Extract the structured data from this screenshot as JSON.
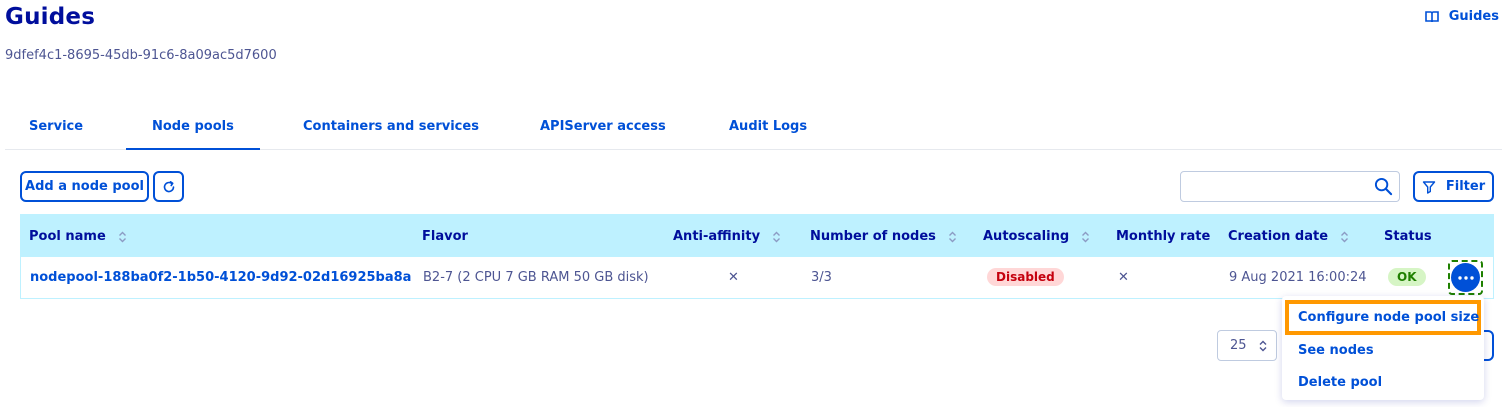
{
  "header": {
    "title": "Guides",
    "service_id": "9dfef4c1-8695-45db-91c6-8a09ac5d7600",
    "guides_link": "Guides"
  },
  "tabs": [
    {
      "label": "Service",
      "active": false
    },
    {
      "label": "Node pools",
      "active": true
    },
    {
      "label": "Containers and services",
      "active": false
    },
    {
      "label": "APIServer access",
      "active": false
    },
    {
      "label": "Audit Logs",
      "active": false
    }
  ],
  "toolbar": {
    "add_label": "Add a node pool",
    "refresh_icon": "refresh-icon",
    "search_value": "",
    "search_icon": "search-icon",
    "filter_label": "Filter",
    "filter_icon": "filter-icon"
  },
  "table": {
    "columns": [
      "Pool name",
      "Flavor",
      "Anti-affinity",
      "Number of nodes",
      "Autoscaling",
      "Monthly rate",
      "Creation date",
      "Status"
    ],
    "rows": [
      {
        "pool_name": "nodepool-188ba0f2-1b50-4120-9d92-02d16925ba8a",
        "flavor": "B2-7 (2 CPU 7 GB RAM 50 GB disk)",
        "anti_affinity": "✕",
        "nodes": "3/3",
        "autoscaling": "Disabled",
        "monthly_rate": "✕",
        "creation_date": "9 Aug 2021 16:00:24",
        "status": "OK"
      }
    ]
  },
  "pagination": {
    "page_size": "25"
  },
  "action_menu": {
    "items": [
      "Configure node pool size",
      "See nodes",
      "Delete pool"
    ]
  },
  "colors": {
    "primary": "#0050d7",
    "heading": "#000e9c",
    "table_header_bg": "#bef1ff",
    "highlight": "#ff9800"
  }
}
